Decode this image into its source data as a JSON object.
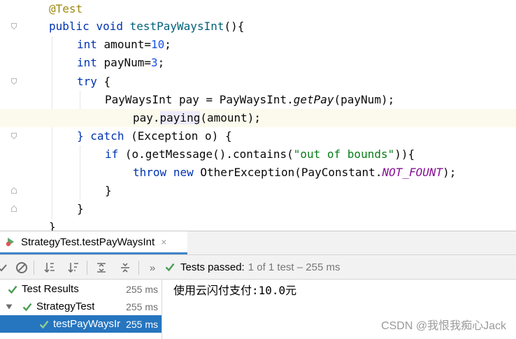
{
  "editor": {
    "lines": [
      {
        "annotation": "@Test"
      },
      {
        "kw1": "public",
        "kw2": "void",
        "method": "testPayWaysInt",
        "rest": "(){"
      },
      {
        "kw": "int",
        "ident": "amount=",
        "num": "10",
        "rest": ";"
      },
      {
        "kw": "int",
        "ident": "payNum=",
        "num": "3",
        "rest": ";"
      },
      {
        "kw": "try",
        "rest": "{"
      },
      {
        "a": "PayWaysInt pay = PayWaysInt.",
        "m": "getPay",
        "b": "(payNum);"
      },
      {
        "a": "pay.",
        "m": "paying",
        "b": "(amount);"
      },
      {
        "brace": "}",
        "kw": "catch",
        "rest": "(Exception o) {"
      },
      {
        "kw": "if",
        "a": "(o.getMessage().contains(",
        "str": "\"out of bounds\"",
        "b": ")){"
      },
      {
        "kw1": "throw",
        "kw2": "new",
        "a": "OtherException(PayConstant.",
        "cst": "NOT_FOUNT",
        "b": ");"
      },
      {
        "text": "}"
      },
      {
        "text": "}"
      },
      {
        "text": "}"
      }
    ]
  },
  "run_panel": {
    "tab_label": "StrategyTest.testPayWaysInt",
    "tab_close": "×",
    "overflow": "»",
    "status_passed": "Tests passed:",
    "status_detail": "1 of 1 test – 255 ms",
    "tree": [
      {
        "label": "Test Results",
        "duration": "255 ms"
      },
      {
        "label": "StrategyTest",
        "duration": "255 ms"
      },
      {
        "label": "testPayWaysIr",
        "duration": "255 ms"
      }
    ],
    "console_output": "使用云闪付支付:10.0元",
    "watermark": "CSDN @我恨我痴心Jack"
  },
  "colors": {
    "keyword": "#0033b3",
    "annotation": "#9e880d",
    "number": "#1750eb",
    "string": "#067d17",
    "constant": "#871094",
    "selection": "#2675bf",
    "pass_green": "#499c54"
  }
}
